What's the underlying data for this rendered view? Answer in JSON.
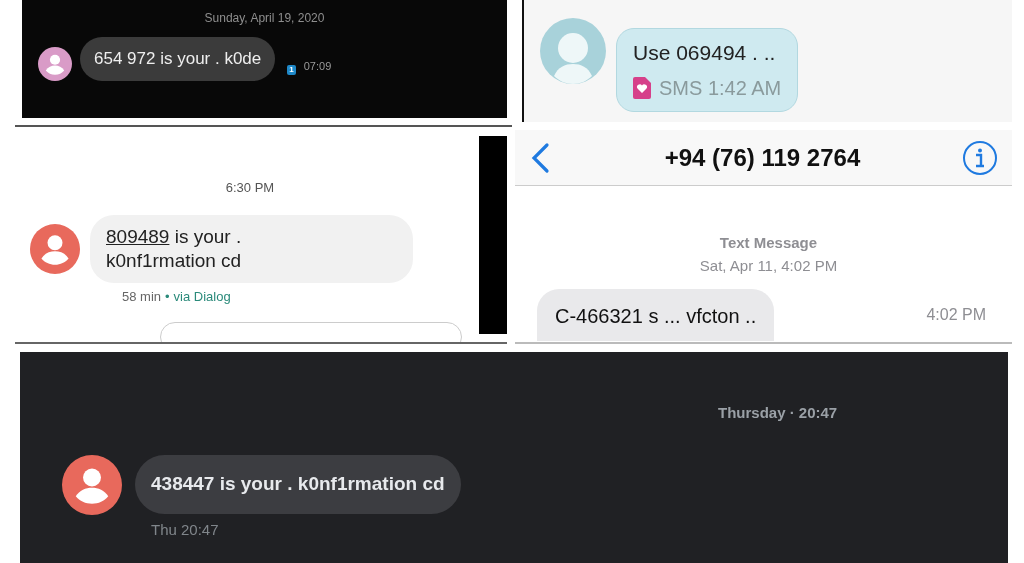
{
  "top_left": {
    "date": "Sunday, April 19, 2020",
    "message": "654 972 is your . k0de",
    "sim": "1",
    "time": "07:09"
  },
  "top_right": {
    "message": "Use 069494 . ..",
    "meta": "SMS 1:42 AM"
  },
  "middle_left": {
    "time": "6:30 PM",
    "code": "809489",
    "message": "is your . k0nf1rmation cd",
    "age": "58 min",
    "separator": "•",
    "via": "via Dialog"
  },
  "middle_right": {
    "title": "+94 (76) 119 2764",
    "service": "Text Message",
    "date": "Sat, Apr 11, 4:02 PM",
    "message": "C-466321 s ... vfcton ..",
    "time": "4:02 PM"
  },
  "bottom": {
    "date": "Thursday · 20:47",
    "message": "438447 is your . k0nf1rmation cd",
    "time": "Thu 20:47"
  }
}
